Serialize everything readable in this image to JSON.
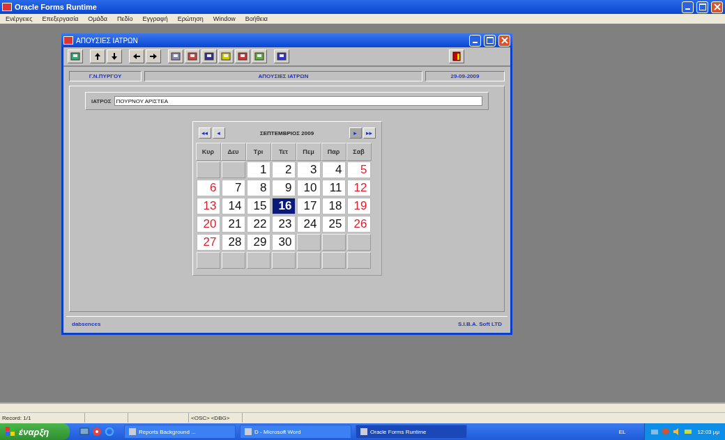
{
  "app": {
    "title": "Oracle Forms Runtime"
  },
  "menu": [
    "Ενέργειες",
    "Επεξεργασία",
    "Ομάδα",
    "Πεδίο",
    "Εγγραφή",
    "Ερώτηση",
    "Window",
    "Βοήθεια"
  ],
  "form_window": {
    "title": "ΑΠΟΥΣΙΕΣ ΙΑΤΡΩΝ"
  },
  "header": {
    "left": "Γ.Ν.ΠΥΡΓΟΥ",
    "center": "ΑΠΟΥΣΙΕΣ ΙΑΤΡΩΝ",
    "right": "29-09-2009"
  },
  "doctor": {
    "label": "ΙΑΤΡΟΣ",
    "value": "ΠΟΥΡΝΟΥ ΑΡΙΣΤΕΑ"
  },
  "calendar": {
    "month": "ΣΕΠΤΕΜΒΡΙΟΣ 2009",
    "prev_year": "◂◂",
    "prev_month": "◂",
    "next_month": "▸",
    "next_year": "▸▸",
    "weekdays": [
      "Κυρ",
      "Δευ",
      "Τρι",
      "Τετ",
      "Πεμ",
      "Παρ",
      "Σαβ"
    ],
    "weeks": [
      [
        {
          "kind": "blank"
        },
        {
          "kind": "blank"
        },
        {
          "kind": "day",
          "day": "1",
          "weekend": false,
          "selected": false
        },
        {
          "kind": "day",
          "day": "2",
          "weekend": false,
          "selected": false
        },
        {
          "kind": "day",
          "day": "3",
          "weekend": false,
          "selected": false
        },
        {
          "kind": "day",
          "day": "4",
          "weekend": false,
          "selected": false
        },
        {
          "kind": "day",
          "day": "5",
          "weekend": true,
          "selected": false
        }
      ],
      [
        {
          "kind": "day",
          "day": "6",
          "weekend": true,
          "selected": false
        },
        {
          "kind": "day",
          "day": "7",
          "weekend": false,
          "selected": false
        },
        {
          "kind": "day",
          "day": "8",
          "weekend": false,
          "selected": false
        },
        {
          "kind": "day",
          "day": "9",
          "weekend": false,
          "selected": false
        },
        {
          "kind": "day",
          "day": "10",
          "weekend": false,
          "selected": false
        },
        {
          "kind": "day",
          "day": "11",
          "weekend": false,
          "selected": false
        },
        {
          "kind": "day",
          "day": "12",
          "weekend": true,
          "selected": false
        }
      ],
      [
        {
          "kind": "day",
          "day": "13",
          "weekend": true,
          "selected": false
        },
        {
          "kind": "day",
          "day": "14",
          "weekend": false,
          "selected": false
        },
        {
          "kind": "day",
          "day": "15",
          "weekend": false,
          "selected": false
        },
        {
          "kind": "day",
          "day": "16",
          "weekend": false,
          "selected": true
        },
        {
          "kind": "day",
          "day": "17",
          "weekend": false,
          "selected": false
        },
        {
          "kind": "day",
          "day": "18",
          "weekend": false,
          "selected": false
        },
        {
          "kind": "day",
          "day": "19",
          "weekend": true,
          "selected": false
        }
      ],
      [
        {
          "kind": "day",
          "day": "20",
          "weekend": true,
          "selected": false
        },
        {
          "kind": "day",
          "day": "21",
          "weekend": false,
          "selected": false
        },
        {
          "kind": "day",
          "day": "22",
          "weekend": false,
          "selected": false
        },
        {
          "kind": "day",
          "day": "23",
          "weekend": false,
          "selected": false
        },
        {
          "kind": "day",
          "day": "24",
          "weekend": false,
          "selected": false
        },
        {
          "kind": "day",
          "day": "25",
          "weekend": false,
          "selected": false
        },
        {
          "kind": "day",
          "day": "26",
          "weekend": true,
          "selected": false
        }
      ],
      [
        {
          "kind": "day",
          "day": "27",
          "weekend": true,
          "selected": false
        },
        {
          "kind": "day",
          "day": "28",
          "weekend": false,
          "selected": false
        },
        {
          "kind": "day",
          "day": "29",
          "weekend": false,
          "selected": false
        },
        {
          "kind": "day",
          "day": "30",
          "weekend": false,
          "selected": false
        },
        {
          "kind": "blank"
        },
        {
          "kind": "blank"
        },
        {
          "kind": "blank"
        }
      ],
      [
        {
          "kind": "blank"
        },
        {
          "kind": "blank"
        },
        {
          "kind": "blank"
        },
        {
          "kind": "blank"
        },
        {
          "kind": "blank"
        },
        {
          "kind": "blank"
        },
        {
          "kind": "blank"
        }
      ]
    ]
  },
  "footer": {
    "left": "dabsences",
    "right": "S.I.B.A. Soft LTD"
  },
  "status_bar": {
    "record": "Record: 1/1",
    "osc": "<OSC>",
    "dbg": "<DBG>"
  },
  "taskbar": {
    "start": "έναρξη",
    "tasks": [
      {
        "label": "Reports Background ...",
        "selected": false
      },
      {
        "label": "D - Microsoft Word",
        "selected": false
      },
      {
        "label": "Oracle Forms Runtime",
        "selected": true
      }
    ],
    "language": "EL",
    "clock": "12:03 μμ"
  }
}
